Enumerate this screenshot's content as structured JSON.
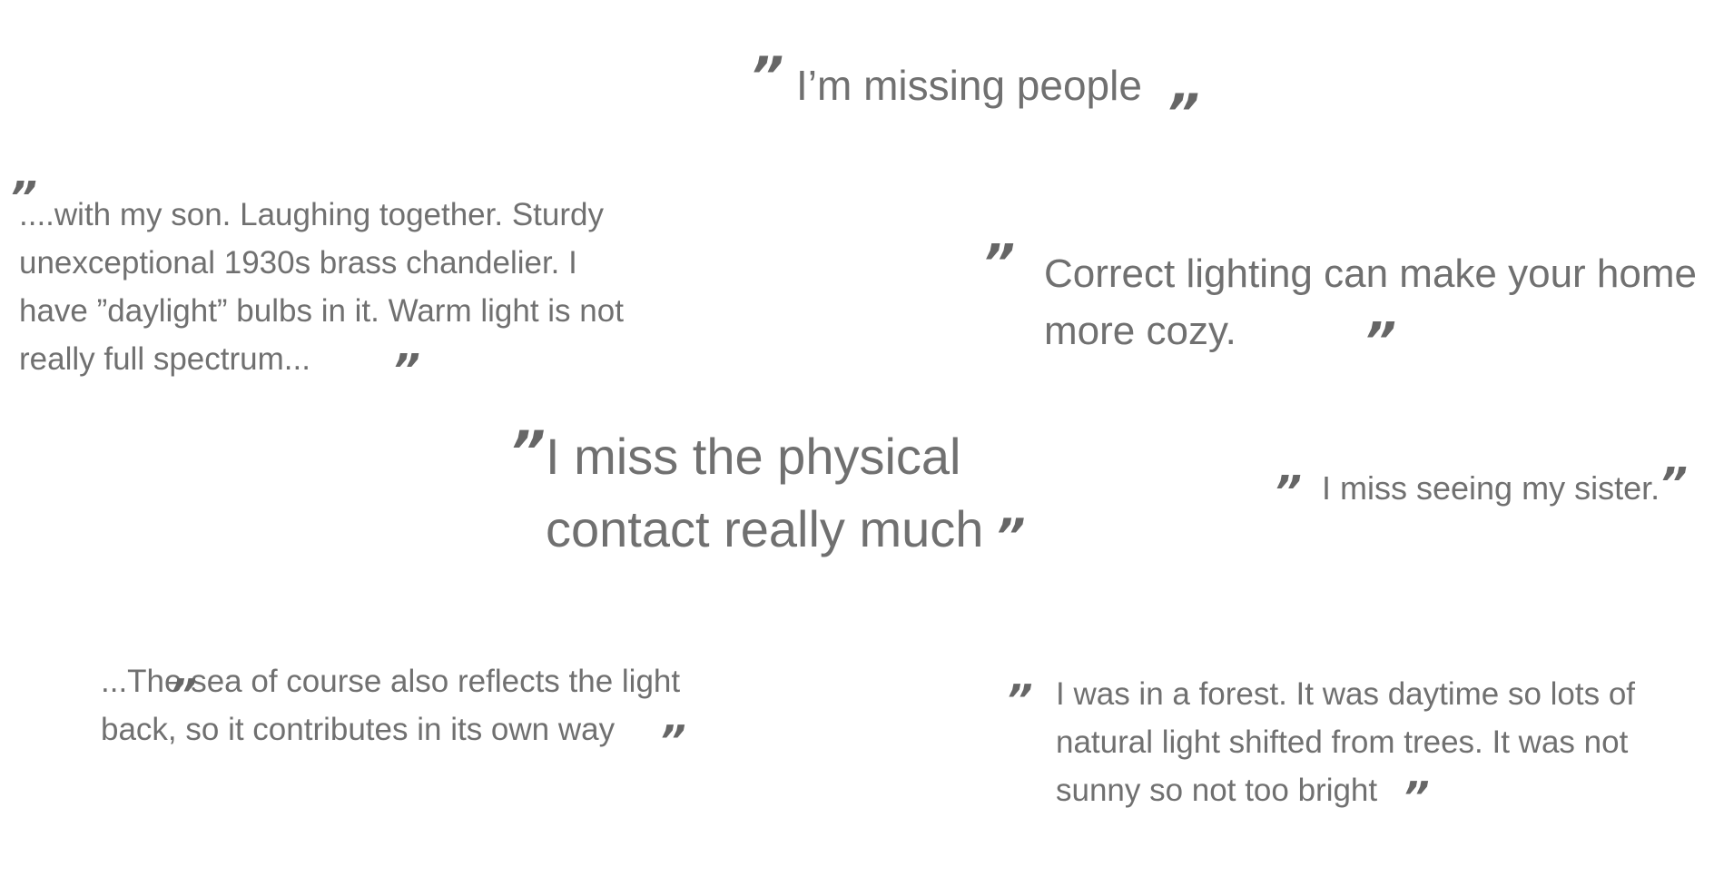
{
  "quote_mark": "”",
  "quotes": [
    {
      "text": "I’m missing people"
    },
    {
      "text": "....with my son. Laughing together. Sturdy unexceptional 1930s brass chandelier. I have ”daylight” bulbs in it. Warm light is not really full spectrum..."
    },
    {
      "text": "Correct lighting can make your home more cozy."
    },
    {
      "text": "I miss the physical contact really much"
    },
    {
      "text": "I miss seeing my sister."
    },
    {
      "text": "...The sea of course also reflects the light back, so it contributes in its own way"
    },
    {
      "text": "I was in a forest. It was daytime so lots of natural light shifted from trees. It was not sunny so not too bright"
    }
  ]
}
